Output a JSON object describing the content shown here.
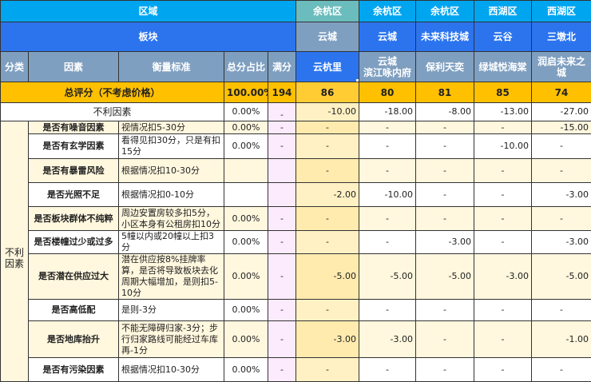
{
  "header": {
    "region_label": "区域",
    "sector_label": "板块",
    "columns": [
      "分类",
      "因素",
      "衡量标准",
      "总分占比",
      "满分"
    ],
    "projects": [
      {
        "region": "余杭区",
        "sector": "云城",
        "name": "云杭里"
      },
      {
        "region": "余杭区",
        "sector": "云城",
        "name": "云城\n滨江咏内府"
      },
      {
        "region": "余杭区",
        "sector": "未来科技城",
        "name": "保利天奕"
      },
      {
        "region": "西湖区",
        "sector": "云谷",
        "name": "绿城悦海棠"
      },
      {
        "region": "西湖区",
        "sector": "三墩北",
        "name": "润启未来之城"
      }
    ]
  },
  "total": {
    "label": "总评分（不考虑价格）",
    "share": "100.00%",
    "full": "194",
    "scores": [
      "86",
      "80",
      "81",
      "85",
      "74"
    ]
  },
  "negative_summary": {
    "label": "不利因素",
    "share": "0.00%",
    "full": "-",
    "values": [
      "-10.00",
      "-18.00",
      "-8.00",
      "-13.00",
      "-27.00"
    ]
  },
  "category": "不利\n因素",
  "rows": [
    {
      "factor": "是否有噪音因素",
      "criteria": "视情况扣5-30分",
      "share": "0.00%",
      "full": "-",
      "values": [
        "-",
        "-",
        "-",
        "-",
        "-15.00"
      ]
    },
    {
      "factor": "是否有玄学因素",
      "criteria": "看得见扣30分，只是有扣15分",
      "share": "0.00%",
      "full": "-",
      "values": [
        "-",
        "-",
        "-",
        "-10.00",
        "-"
      ]
    },
    {
      "factor": "是否有暴雷风险",
      "criteria": "根据情况扣10-30分",
      "share": "",
      "full": "",
      "values": [
        "-",
        "-",
        "-",
        "-",
        "-"
      ]
    },
    {
      "factor": "是否光照不足",
      "criteria": "根据情况扣0-10分",
      "share": "",
      "full": "",
      "values": [
        "-2.00",
        "-10.00",
        "-",
        "-",
        "-3.00"
      ]
    },
    {
      "factor": "是否板块群体不纯粹",
      "criteria": "周边安置房较多扣5分，小区本身有公租房扣10分",
      "share": "0.00%",
      "full": "-",
      "values": [
        "-",
        "-",
        "-",
        "-",
        "-"
      ]
    },
    {
      "factor": "是否楼幢过少或过多",
      "criteria": "5幢以内或20幢以上扣3分",
      "share": "0.00%",
      "full": "-",
      "values": [
        "-",
        "-",
        "-3.00",
        "-",
        "-3.00"
      ]
    },
    {
      "factor": "是否潜在供应过大",
      "criteria": "潜在供应按8%挂牌率算，是否将导致板块去化周期大幅增加，是则扣5-10分",
      "share": "0.00%",
      "full": "-",
      "values": [
        "-5.00",
        "-5.00",
        "-5.00",
        "-3.00",
        "-5.00"
      ]
    },
    {
      "factor": "是否高低配",
      "criteria": "是则-3分",
      "share": "0.00%",
      "full": "-",
      "values": [
        "-",
        "-",
        "-",
        "-",
        "-"
      ]
    },
    {
      "factor": "是否地库抬升",
      "criteria": "不能无障碍归家-3分；步行归家路线可能经过车库再-1分",
      "share": "0.00%",
      "full": "-",
      "values": [
        "-3.00",
        "-3.00",
        "-",
        "-",
        "-1.00"
      ]
    },
    {
      "factor": "是否有污染因素",
      "criteria": "根据情况扣10-30分",
      "share": "0.00%",
      "full": "-",
      "values": [
        "-",
        "-",
        "-",
        "-",
        "-"
      ]
    }
  ]
}
